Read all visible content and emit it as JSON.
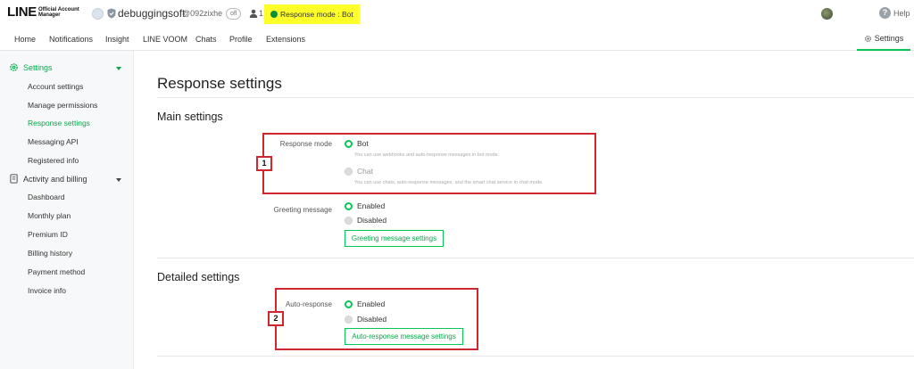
{
  "header": {
    "logo_main": "LINE",
    "logo_sub": "Official Account Manager",
    "account_name": "debuggingsoft",
    "account_id": "@092zixhe",
    "account_badge": "ofl",
    "friend_count": "1",
    "response_mode": "Response mode : Bot",
    "help": "Help"
  },
  "nav": {
    "tabs": [
      "Home",
      "Notifications",
      "Insight",
      "LINE VOOM",
      "Chats",
      "Profile",
      "Extensions"
    ],
    "settings": "Settings"
  },
  "sidebar": {
    "settings_group": "Settings",
    "settings_items": [
      "Account settings",
      "Manage permissions",
      "Response settings",
      "Messaging API",
      "Registered info"
    ],
    "billing_group": "Activity and billing",
    "billing_items": [
      "Dashboard",
      "Monthly plan",
      "Premium ID",
      "Billing history",
      "Payment method",
      "Invoice info"
    ]
  },
  "main": {
    "title": "Response settings",
    "main_settings": {
      "heading": "Main settings",
      "response_mode_label": "Response mode",
      "bot_label": "Bot",
      "bot_hint": "You can use webhooks and auto-response messages in bot mode.",
      "chat_label": "Chat",
      "chat_hint": "You can use chats, auto-response messages, and the smart chat service in chat mode.",
      "greeting_label": "Greeting message",
      "greeting_enabled": "Enabled",
      "greeting_disabled": "Disabled",
      "greeting_button": "Greeting message settings"
    },
    "detailed_settings": {
      "heading": "Detailed settings",
      "auto_label": "Auto-response",
      "auto_enabled": "Enabled",
      "auto_disabled": "Disabled",
      "auto_button": "Auto-response message settings"
    }
  },
  "annotations": {
    "one": "1",
    "two": "2"
  },
  "colors": {
    "accent": "#06c755",
    "highlight": "#ffff2a",
    "annotation": "#d0262e"
  }
}
